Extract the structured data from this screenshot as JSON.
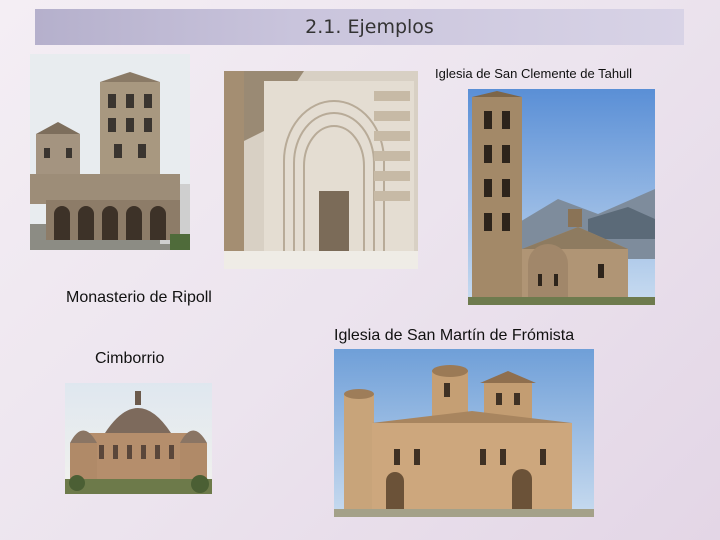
{
  "slide": {
    "title": "2.1. Ejemplos"
  },
  "captions": {
    "ripoll": "Monasterio de Ripoll",
    "tahull": "Iglesia de San Clemente de Tahull",
    "fromista": "Iglesia de San Martín de Frómista",
    "cimborrio": "Cimborrio"
  }
}
